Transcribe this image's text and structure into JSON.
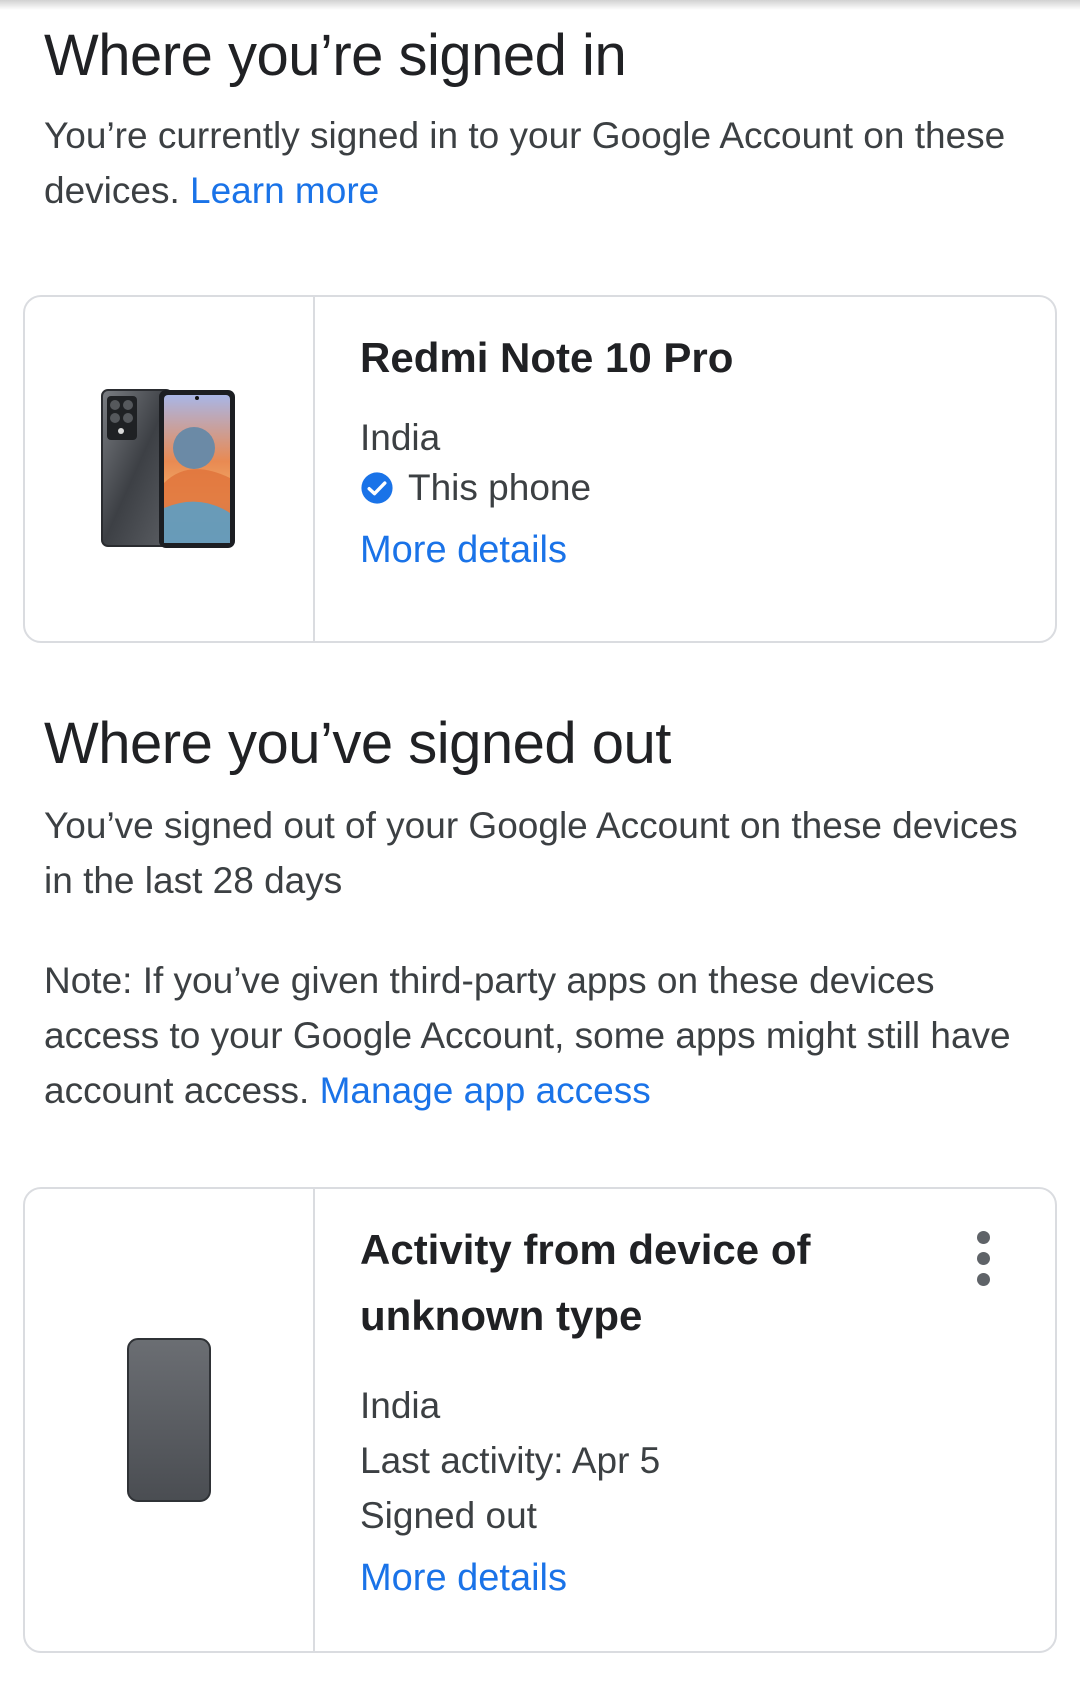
{
  "signed_in": {
    "title": "Where you’re signed in",
    "description": "You’re currently signed in to your Google Account on these devices.",
    "learn_more_label": "Learn more",
    "device": {
      "name": "Redmi Note 10 Pro",
      "location": "India",
      "status": "This phone",
      "more_details_label": "More details",
      "icon": "phone-image"
    }
  },
  "signed_out": {
    "title": "Where you’ve signed out",
    "description": "You’ve signed out of your Google Account on these devices in the last 28 days",
    "note": "Note: If you’ve given third-party apps on these devices access to your Google Account, some apps might still have account access.",
    "manage_app_access_label": "Manage app access",
    "device": {
      "name": "Activity from device of unknown type",
      "location": "India",
      "last_activity": "Last activity: Apr 5",
      "status": "Signed out",
      "more_details_label": "More details",
      "icon": "generic-phone-icon",
      "menu_icon": "more-vert-icon"
    }
  },
  "colors": {
    "link": "#1a73e8",
    "verified": "#1a73e8",
    "border": "#dadce0",
    "text_primary": "#202124",
    "text_secondary": "#3c4043"
  }
}
